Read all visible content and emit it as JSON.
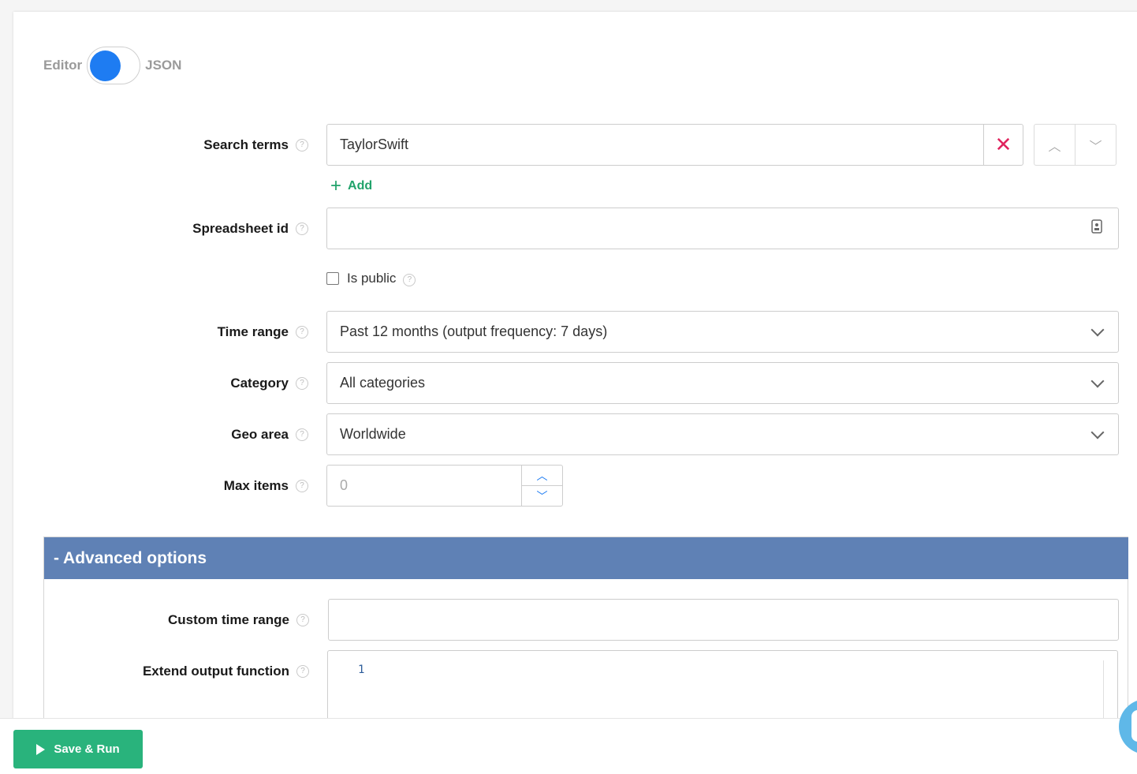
{
  "toggle": {
    "left_label": "Editor",
    "right_label": "JSON"
  },
  "fields": {
    "search_terms": {
      "label": "Search terms",
      "value": "TaylorSwift",
      "add_label": "Add"
    },
    "spreadsheet_id": {
      "label": "Spreadsheet id",
      "value": ""
    },
    "is_public": {
      "label": "Is public",
      "checked": false
    },
    "time_range": {
      "label": "Time range",
      "value": "Past 12 months (output frequency: 7 days)"
    },
    "category": {
      "label": "Category",
      "value": "All categories"
    },
    "geo_area": {
      "label": "Geo area",
      "value": "Worldwide"
    },
    "max_items": {
      "label": "Max items",
      "placeholder": "0"
    }
  },
  "advanced": {
    "title": "- Advanced options",
    "custom_time_range": {
      "label": "Custom time range",
      "value": ""
    },
    "extend_output_function": {
      "label": "Extend output function",
      "line_number": "1"
    }
  },
  "help_glyph": "?",
  "footer": {
    "save_run_label": "Save & Run"
  },
  "colors": {
    "toggle_knob": "#1e7cf2",
    "accent_green": "#21a36b",
    "save_button": "#29b37c",
    "advanced_header": "#5f81b5",
    "clear_red": "#e0245e",
    "chat_bubble": "#5fb8e8"
  }
}
